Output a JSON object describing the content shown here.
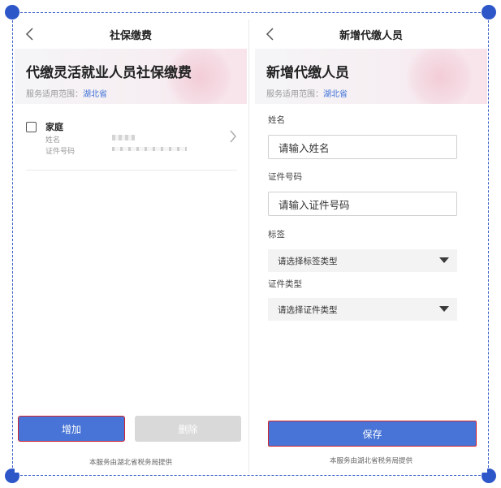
{
  "left": {
    "nav_title": "社保缴费",
    "heading": "代缴灵活就业人员社保缴费",
    "scope_label": "服务适用范围：",
    "scope_value": "湖北省",
    "member": {
      "name": "家庭",
      "name_label": "姓名",
      "id_label": "证件号码"
    },
    "add_button": "增加",
    "delete_button": "删除",
    "footer": "本服务由湖北省税务局提供"
  },
  "right": {
    "nav_title": "新增代缴人员",
    "heading": "新增代缴人员",
    "scope_label": "服务适用范围：",
    "scope_value": "湖北省",
    "fields": {
      "name_label": "姓名",
      "name_placeholder": "请输入姓名",
      "id_label": "证件号码",
      "id_placeholder": "请输入证件号码",
      "tag_label": "标签",
      "tag_select": "请选择标签类型",
      "idtype_label": "证件类型",
      "idtype_select": "请选择证件类型"
    },
    "save_button": "保存",
    "footer": "本服务由湖北省税务局提供"
  },
  "colors": {
    "primary": "#4774d6",
    "highlight_border": "#d1242f",
    "disabled": "#d9d9d9",
    "link": "#3b6fd8",
    "selection_handle": "#2d56c9"
  },
  "icons": [
    "back-arrow-icon",
    "chevron-right-icon",
    "dropdown-triangle-icon"
  ]
}
